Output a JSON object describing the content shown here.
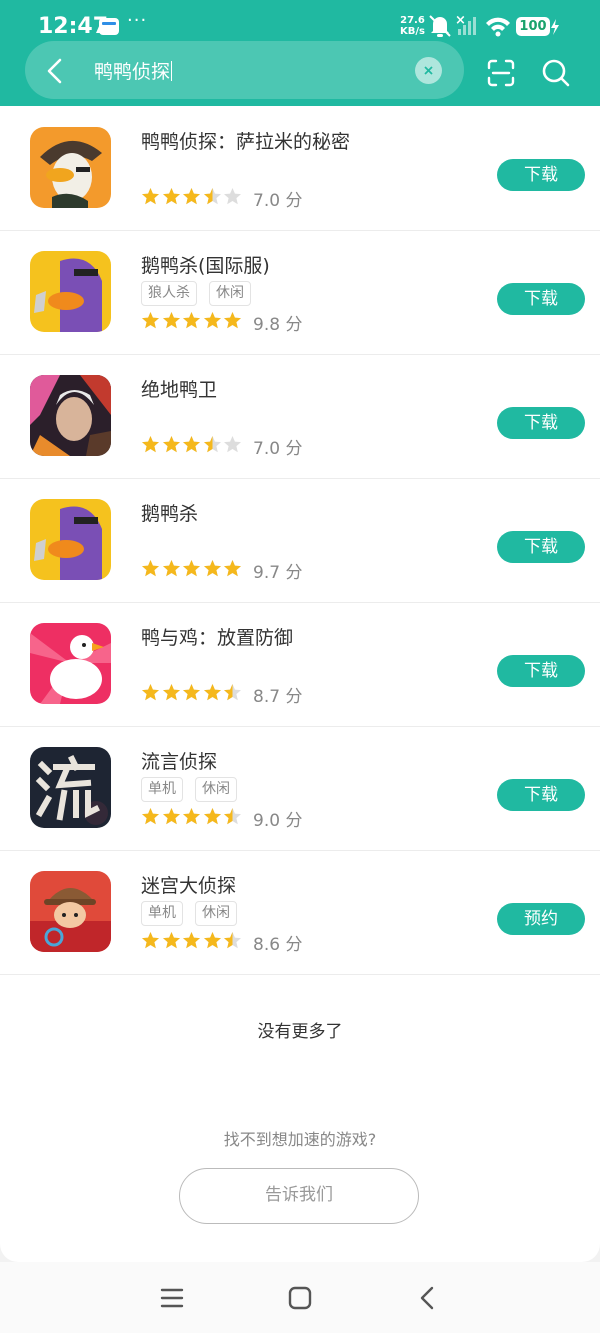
{
  "status": {
    "time": "12:47",
    "net_speed_value": "27.6",
    "net_speed_unit": "KB/s",
    "battery": "100"
  },
  "search": {
    "query": "鸭鸭侦探"
  },
  "apps": [
    {
      "name": "鸭鸭侦探：萨拉米的秘密",
      "tags": [],
      "rating": 3.5,
      "score": "7.0 分",
      "action": "下载"
    },
    {
      "name": "鹅鸭杀(国际服)",
      "tags": [
        "狼人杀",
        "休闲"
      ],
      "rating": 5,
      "score": "9.8 分",
      "action": "下载"
    },
    {
      "name": "绝地鸭卫",
      "tags": [],
      "rating": 3.5,
      "score": "7.0 分",
      "action": "下载"
    },
    {
      "name": "鹅鸭杀",
      "tags": [],
      "rating": 5,
      "score": "9.7 分",
      "action": "下载"
    },
    {
      "name": "鸭与鸡：放置防御",
      "tags": [],
      "rating": 4.5,
      "score": "8.7 分",
      "action": "下载"
    },
    {
      "name": "流言侦探",
      "tags": [
        "单机",
        "休闲"
      ],
      "rating": 4.5,
      "score": "9.0 分",
      "action": "下载"
    },
    {
      "name": "迷宫大侦探",
      "tags": [
        "单机",
        "休闲"
      ],
      "rating": 4.5,
      "score": "8.6 分",
      "action": "预约"
    }
  ],
  "footer": {
    "no_more": "没有更多了",
    "hint": "找不到想加速的游戏?",
    "tell_us": "告诉我们"
  },
  "colors": {
    "accent": "#20b9a1",
    "star": "#f5b81c",
    "star_empty": "#dddddd"
  }
}
